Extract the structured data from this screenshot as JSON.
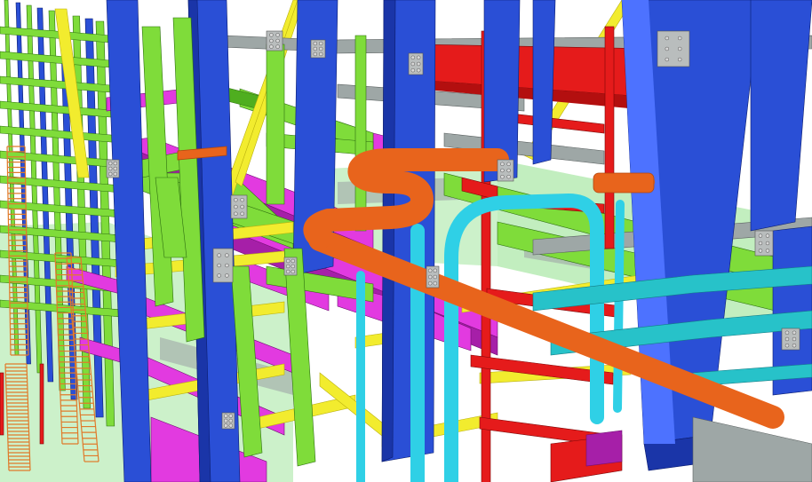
{
  "scene": {
    "type": "3D BIM steel structure model render",
    "background": "#ffffff",
    "palette": {
      "column_blue": "#2a4fd6",
      "column_blue_dark": "#1a35a8",
      "beam_green": "#7fdc3a",
      "beam_green_dark": "#4fae1f",
      "beam_magenta": "#e23ae0",
      "beam_magenta_dark": "#a61fa8",
      "pipe_orange": "#e8641c",
      "pipe_orange_dark": "#b1460e",
      "pipe_cyan": "#2fd0e6",
      "pipe_cyan_dark": "#1a9aae",
      "beam_red": "#e51b1b",
      "beam_yellow": "#f2ec2e",
      "beam_yellow_dark": "#b9b00f",
      "grating_green": "#8fe08a",
      "deck_grey": "#9ea7a6",
      "ladder_orange": "#e07a2a",
      "pipe_teal": "#27c2c9"
    },
    "components": [
      "column-steel",
      "beam-steel",
      "bracing-diagonal",
      "pipe-orange",
      "pipe-cyan",
      "pipe-yellow",
      "ladder",
      "grating-floor",
      "bolted-connection-plate"
    ]
  }
}
